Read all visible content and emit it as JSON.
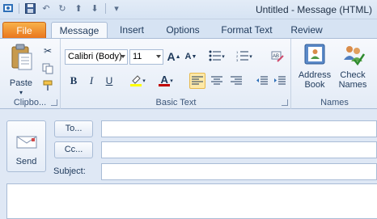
{
  "window": {
    "title": "Untitled - Message (HTML)"
  },
  "qat": {
    "icons": [
      "outlook-icon",
      "save-icon",
      "undo-icon",
      "redo-icon",
      "up-arrow-icon",
      "down-arrow-icon",
      "customize-icon"
    ]
  },
  "tabs": [
    "File",
    "Message",
    "Insert",
    "Options",
    "Format Text",
    "Review"
  ],
  "active_tab": "Message",
  "ribbon": {
    "clipboard": {
      "paste_label": "Paste",
      "group_label": "Clipbo..."
    },
    "basic_text": {
      "font_name": "Calibri (Body)",
      "font_size": "11",
      "bold": "B",
      "italic": "I",
      "underline": "U",
      "font_color_letter": "A",
      "grow": "A",
      "shrink": "A",
      "group_label": "Basic Text"
    },
    "names": {
      "address_book_line1": "Address",
      "address_book_line2": "Book",
      "check_names_line1": "Check",
      "check_names_line2": "Names",
      "group_label": "Names"
    }
  },
  "compose": {
    "send_label": "Send",
    "to_label": "To...",
    "cc_label": "Cc...",
    "subject_label": "Subject:",
    "to_value": "",
    "cc_value": "",
    "subject_value": "",
    "body_value": ""
  },
  "colors": {
    "file_tab": "#e8731c",
    "highlight": "#ffff00",
    "font_color": "#c00000",
    "ribbon_bg": "#e3ebf6"
  }
}
